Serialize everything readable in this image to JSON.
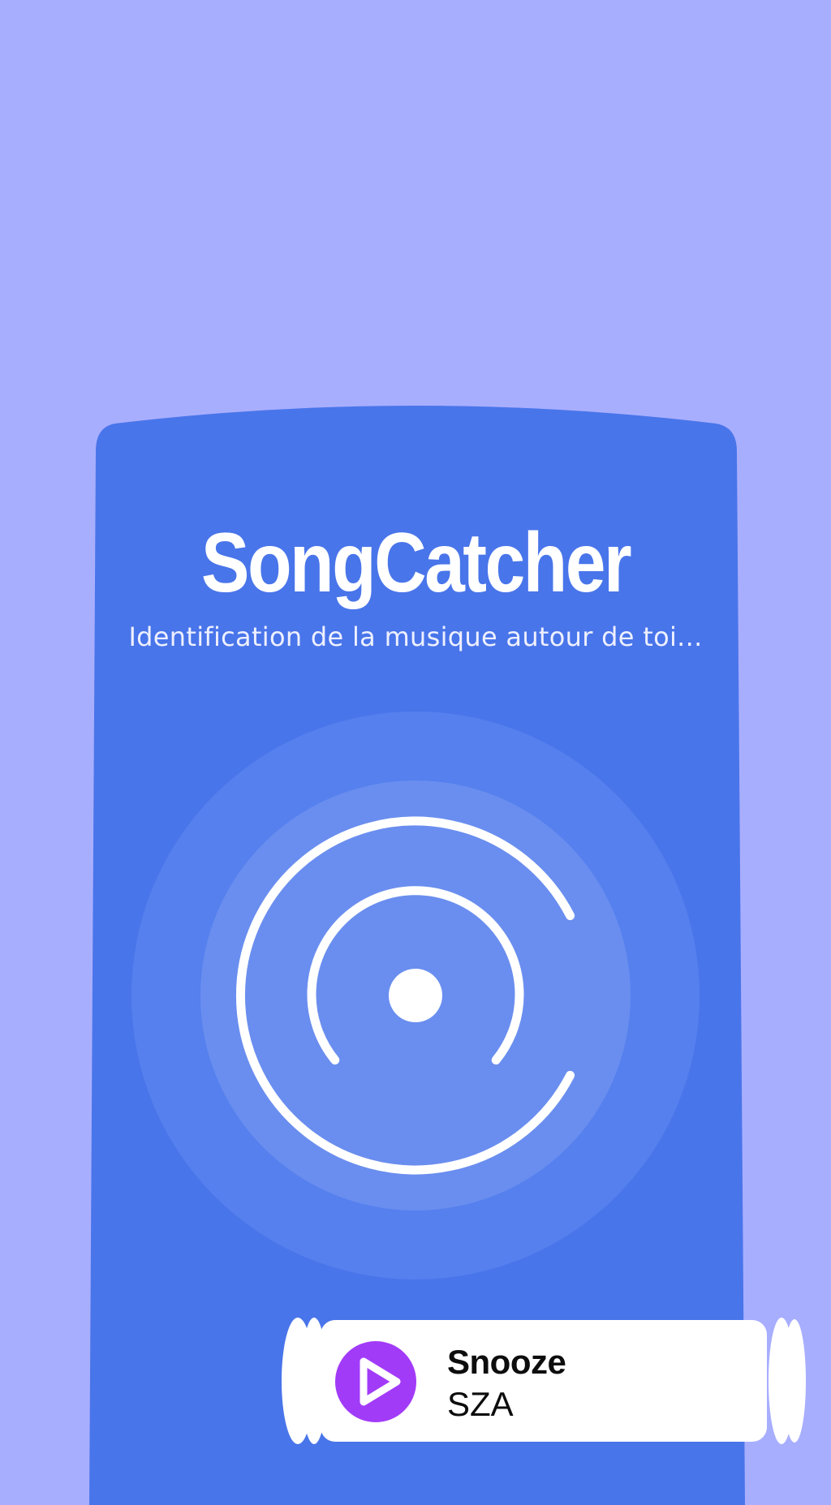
{
  "app": {
    "title": "SongCatcher",
    "subtitle": "Identification de la musique autour de toi..."
  },
  "listen_button": {
    "icon": "listening-rings-icon"
  },
  "now_playing": {
    "song_title": "Snooze",
    "artist": "SZA",
    "play_icon": "play-icon"
  },
  "colors": {
    "background": "#a8aefe",
    "card": "#4975ea",
    "accent": "#a23bf8",
    "text_light": "#ffffff"
  }
}
